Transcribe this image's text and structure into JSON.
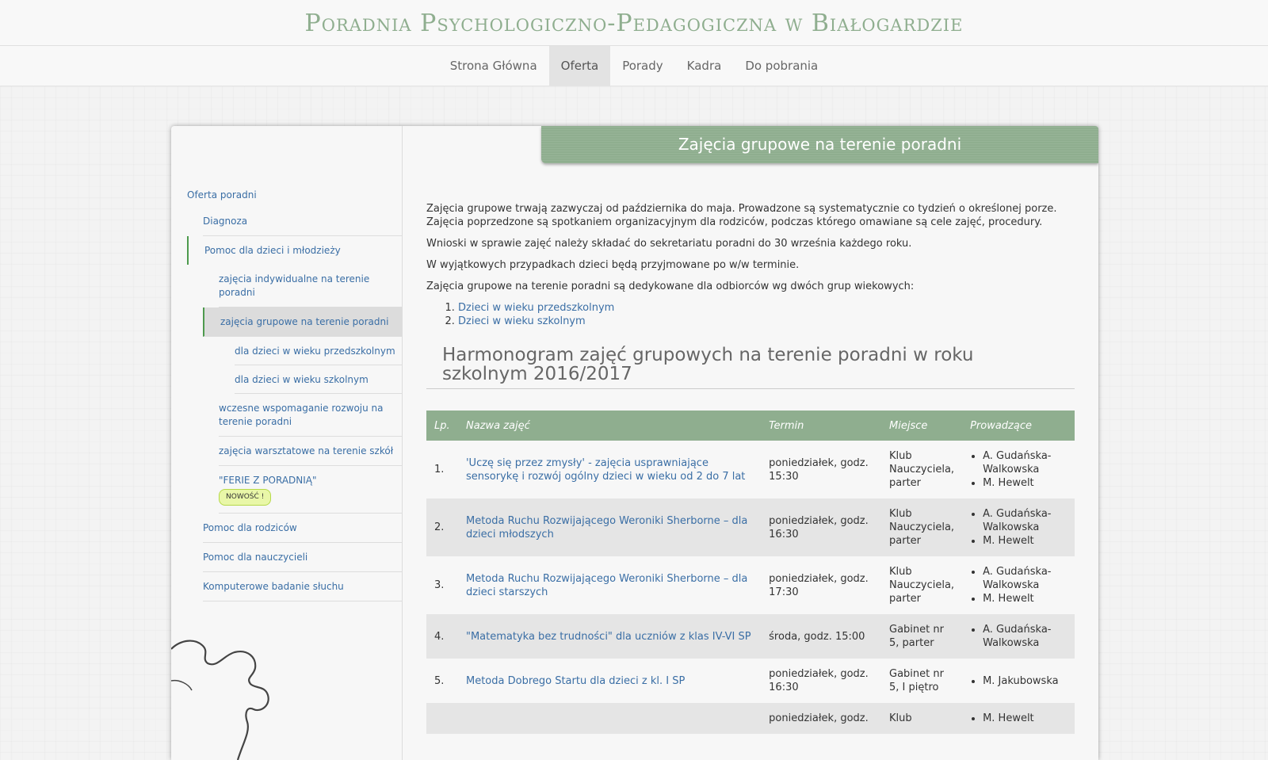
{
  "header": {
    "title": "Poradnia Psychologiczno-Pedagogiczna w Białogardzie"
  },
  "nav": [
    "Strona Główna",
    "Oferta",
    "Porady",
    "Kadra",
    "Do pobrania"
  ],
  "nav_active": "Oferta",
  "sidebar": {
    "root": "Oferta poradni",
    "diagnoza": "Diagnoza",
    "pomoc_dzieci": "Pomoc dla dzieci i młodzieży",
    "indywidualne": "zajęcia indywidualne na terenie poradni",
    "grupowe": "zajęcia grupowe na terenie poradni",
    "przedszkolne": "dla dzieci w wieku przedszkolnym",
    "szkolne": "dla dzieci w wieku szkolnym",
    "wczesne": "wczesne wspomaganie rozwoju na terenie poradni",
    "warsztatowe": "zajęcia warsztatowe na terenie szkół",
    "ferie": "\"FERIE Z PORADNIĄ\"",
    "badge": "NOWOŚĆ !",
    "rodzice": "Pomoc dla rodziców",
    "nauczyciele": "Pomoc dla nauczycieli",
    "sluch": "Komputerowe badanie słuchu"
  },
  "main": {
    "heading": "Zajęcia grupowe na terenie poradni",
    "p1": "Zajęcia grupowe trwają zazwyczaj od października do maja. Prowadzone są systematycznie co tydzień o określonej porze. Zajęcia poprzedzone są spotkaniem organizacyjnym dla rodziców, podczas którego omawiane są cele zajęć, procedury.",
    "p2": "Wnioski w sprawie zajęć należy składać do sekretariatu poradni do 30 września każdego roku.",
    "p3": "W wyjątkowych przypadkach dzieci będą przyjmowane po w/w terminie.",
    "p4": "Zajęcia grupowe na terenie poradni są dedykowane dla odbiorców wg dwóch grup wiekowych:",
    "groups": [
      "Dzieci w wieku przedszkolnym",
      "Dzieci w wieku szkolnym"
    ],
    "section_title": "Harmonogram zajęć grupowych na terenie poradni w roku szkolnym 2016/2017"
  },
  "table": {
    "headers": {
      "lp": "Lp.",
      "name": "Nazwa zajęć",
      "term": "Termin",
      "place": "Miejsce",
      "leaders": "Prowadzące"
    },
    "rows": [
      {
        "lp": "1.",
        "name": "'Uczę się przez zmysły' - zajęcia usprawniające sensorykę i rozwój ogólny dzieci w wieku od 2 do 7 lat",
        "term": "poniedziałek, godz. 15:30",
        "place": "Klub Nauczyciela, parter",
        "leaders": [
          "A. Gudańska-Walkowska",
          "M. Hewelt"
        ]
      },
      {
        "lp": "2.",
        "name": "Metoda Ruchu Rozwijającego Weroniki Sherborne – dla dzieci młodszych",
        "term": "poniedziałek, godz. 16:30",
        "place": "Klub Nauczyciela, parter",
        "leaders": [
          "A. Gudańska-Walkowska",
          "M. Hewelt"
        ]
      },
      {
        "lp": "3.",
        "name": "Metoda Ruchu Rozwijającego Weroniki Sherborne – dla dzieci starszych",
        "term": "poniedziałek, godz. 17:30",
        "place": "Klub Nauczyciela, parter",
        "leaders": [
          "A. Gudańska-Walkowska",
          "M. Hewelt"
        ]
      },
      {
        "lp": "4.",
        "name": "\"Matematyka bez trudności\" dla uczniów z klas IV-VI SP",
        "term": "środa, godz. 15:00",
        "place": "Gabinet nr 5, parter",
        "leaders": [
          "A. Gudańska-Walkowska"
        ]
      },
      {
        "lp": "5.",
        "name": "Metoda Dobrego Startu dla dzieci z kl. I SP",
        "term": "poniedziałek, godz. 16:30",
        "place": "Gabinet nr 5, I piętro",
        "leaders": [
          "M. Jakubowska"
        ]
      },
      {
        "lp": "",
        "name": "",
        "term": "poniedziałek, godz.",
        "place": "Klub",
        "leaders": [
          "M. Hewelt"
        ]
      }
    ]
  },
  "colors": {
    "accent": "#8fae8f",
    "link": "#3a6ea5",
    "active_border": "#4d9a4d"
  }
}
